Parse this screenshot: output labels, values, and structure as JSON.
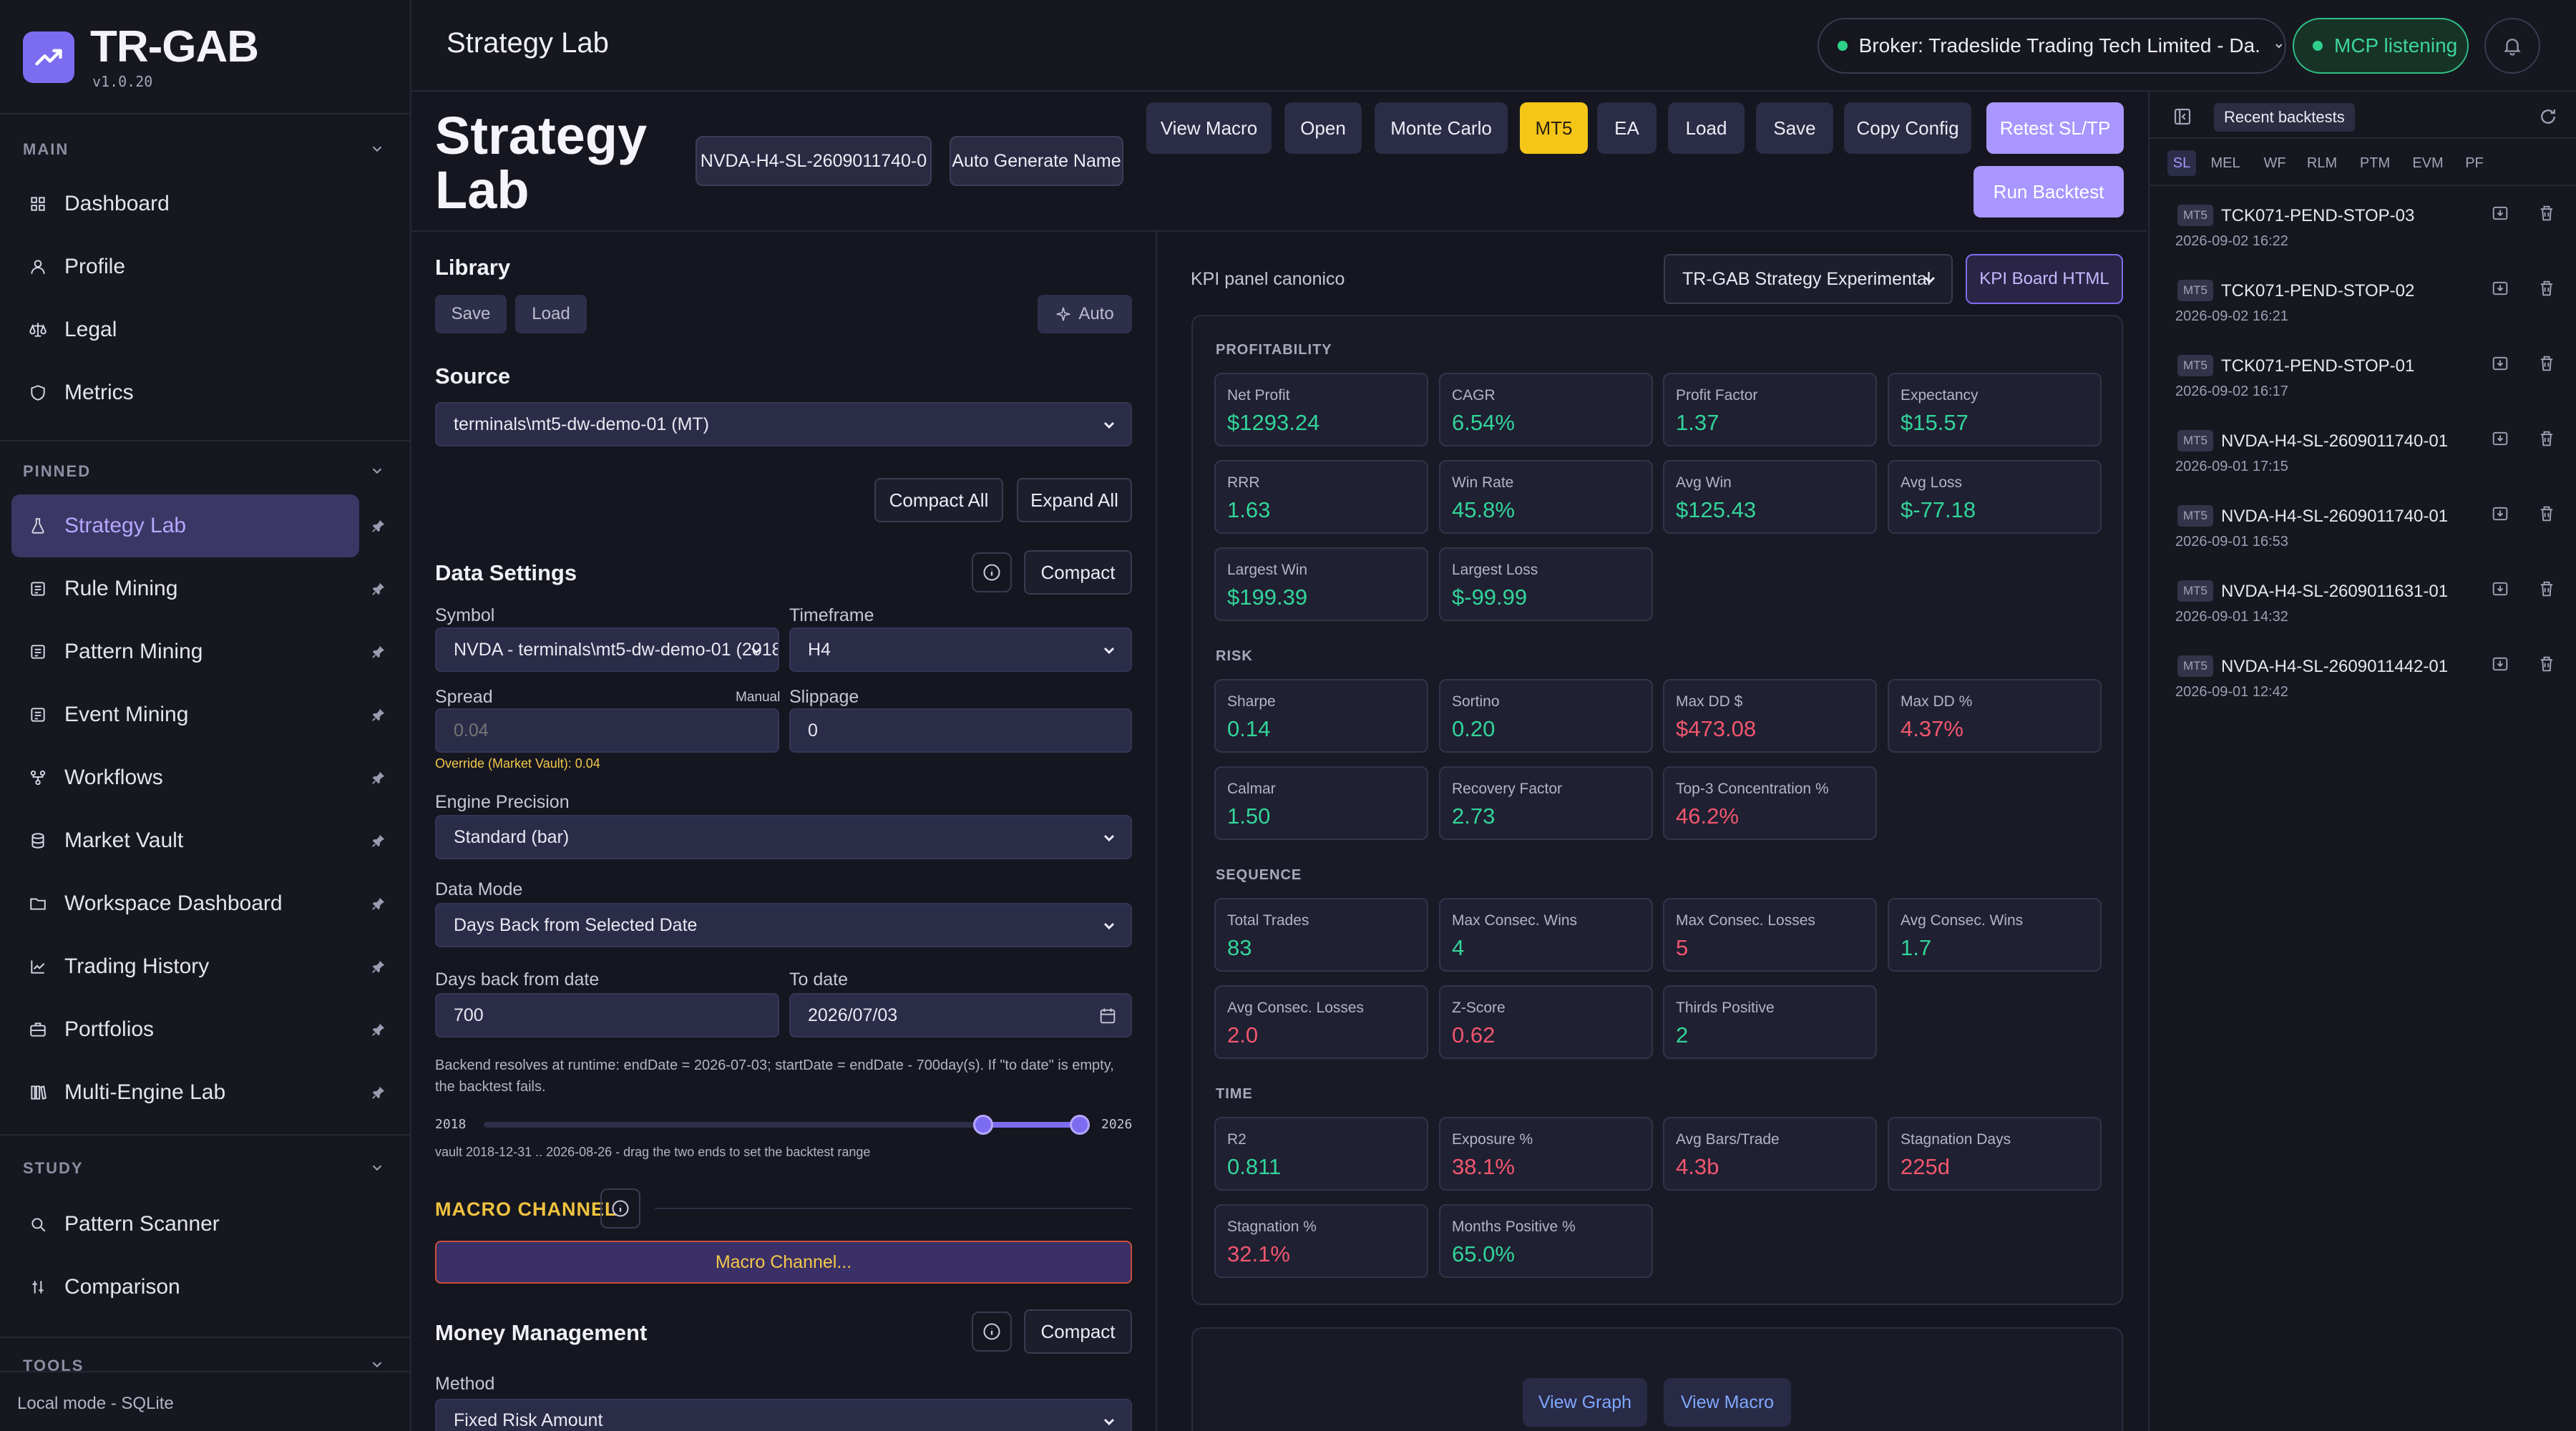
{
  "app": {
    "title": "TR-GAB",
    "version": "v1.0.20",
    "footer": "Local mode - SQLite"
  },
  "sidebar": {
    "sections": {
      "main": "MAIN",
      "pinned": "PINNED",
      "study": "STUDY",
      "tools": "TOOLS"
    },
    "main_items": [
      {
        "label": "Dashboard",
        "icon": "grid-icon"
      },
      {
        "label": "Profile",
        "icon": "user-icon"
      },
      {
        "label": "Legal",
        "icon": "scale-icon"
      },
      {
        "label": "Metrics",
        "icon": "shield-icon"
      }
    ],
    "pinned_items": [
      {
        "label": "Strategy Lab",
        "icon": "flask-icon",
        "active": true
      },
      {
        "label": "Rule Mining",
        "icon": "list-icon"
      },
      {
        "label": "Pattern Mining",
        "icon": "list-icon"
      },
      {
        "label": "Event Mining",
        "icon": "list-icon"
      },
      {
        "label": "Workflows",
        "icon": "workflow-icon"
      },
      {
        "label": "Market Vault",
        "icon": "database-icon"
      },
      {
        "label": "Workspace Dashboard",
        "icon": "folder-icon"
      },
      {
        "label": "Trading History",
        "icon": "chart-icon"
      },
      {
        "label": "Portfolios",
        "icon": "briefcase-icon"
      },
      {
        "label": "Multi-Engine Lab",
        "icon": "books-icon"
      }
    ],
    "study_items": [
      {
        "label": "Pattern Scanner",
        "icon": "search-icon"
      },
      {
        "label": "Comparison",
        "icon": "compare-icon"
      }
    ]
  },
  "topbar": {
    "title": "Strategy Lab",
    "broker": "Broker: Tradeslide Trading Tech Limited - Da...",
    "mcp": "MCP listening",
    "accent": "#7c6cf0"
  },
  "header": {
    "title_line1": "Strategy",
    "title_line2": "Lab",
    "strategy_name": "NVDA-H4-SL-2609011740-0",
    "auto_generate": "Auto Generate Name",
    "buttons": {
      "view_macro": "View Macro",
      "open": "Open",
      "monte_carlo": "Monte Carlo",
      "mt5": "MT5",
      "ea": "EA",
      "load": "Load",
      "save": "Save",
      "copy_config": "Copy Config",
      "retest": "Retest SL/TP",
      "run": "Run Backtest"
    }
  },
  "config": {
    "library": {
      "title": "Library",
      "save": "Save",
      "load": "Load",
      "auto": "Auto"
    },
    "source": {
      "title": "Source",
      "value": "terminals\\mt5-dw-demo-01 (MT)"
    },
    "compact_all": "Compact All",
    "expand_all": "Expand All",
    "data_settings": {
      "title": "Data Settings",
      "compact": "Compact",
      "symbol_label": "Symbol",
      "symbol_value": "NVDA - terminals\\mt5-dw-demo-01 (2018",
      "timeframe_label": "Timeframe",
      "timeframe_value": "H4",
      "spread_label": "Spread",
      "spread_manual": "Manual",
      "spread_placeholder": "0.04",
      "slippage_label": "Slippage",
      "slippage_value": "0",
      "override_note": "Override (Market Vault): 0.04",
      "precision_label": "Engine Precision",
      "precision_value": "Standard (bar)",
      "mode_label": "Data Mode",
      "mode_value": "Days Back from Selected Date",
      "days_label": "Days back from date",
      "days_value": "700",
      "to_label": "To date",
      "to_value": "2026/07/03",
      "backend_note": "Backend resolves at runtime: endDate = 2026-07-03; startDate = endDate - 700day(s). If \"to date\" is empty, the backtest fails.",
      "range_start": "2018",
      "range_end": "2026",
      "range_start_frac": 0.83,
      "range_end_frac": 0.99,
      "vault_note": "vault 2018-12-31 .. 2026-08-26 - drag the two ends to set the backtest range"
    },
    "macro": {
      "title": "MACRO CHANNEL",
      "button": "Macro Channel..."
    },
    "money": {
      "title": "Money Management",
      "compact": "Compact",
      "method_label": "Method",
      "method_value": "Fixed Risk Amount"
    }
  },
  "kpi": {
    "panel_label": "KPI panel canonico",
    "select": "TR-GAB Strategy Experimental",
    "board_btn": "KPI Board HTML",
    "groups": [
      {
        "title": "PROFITABILITY",
        "cards": [
          {
            "label": "Net Profit",
            "value": "$1293.24",
            "tone": "pos"
          },
          {
            "label": "CAGR",
            "value": "6.54%",
            "tone": "pos"
          },
          {
            "label": "Profit Factor",
            "value": "1.37",
            "tone": "pos"
          },
          {
            "label": "Expectancy",
            "value": "$15.57",
            "tone": "pos"
          },
          {
            "label": "RRR",
            "value": "1.63",
            "tone": "pos"
          },
          {
            "label": "Win Rate",
            "value": "45.8%",
            "tone": "pos"
          },
          {
            "label": "Avg Win",
            "value": "$125.43",
            "tone": "pos"
          },
          {
            "label": "Avg Loss",
            "value": "$-77.18",
            "tone": "pos"
          },
          {
            "label": "Largest Win",
            "value": "$199.39",
            "tone": "pos"
          },
          {
            "label": "Largest Loss",
            "value": "$-99.99",
            "tone": "pos"
          }
        ]
      },
      {
        "title": "RISK",
        "cards": [
          {
            "label": "Sharpe",
            "value": "0.14",
            "tone": "pos"
          },
          {
            "label": "Sortino",
            "value": "0.20",
            "tone": "pos"
          },
          {
            "label": "Max DD $",
            "value": "$473.08",
            "tone": "neg"
          },
          {
            "label": "Max DD %",
            "value": "4.37%",
            "tone": "neg"
          },
          {
            "label": "Calmar",
            "value": "1.50",
            "tone": "pos"
          },
          {
            "label": "Recovery Factor",
            "value": "2.73",
            "tone": "pos"
          },
          {
            "label": "Top-3 Concentration %",
            "value": "46.2%",
            "tone": "neg"
          }
        ]
      },
      {
        "title": "SEQUENCE",
        "cards": [
          {
            "label": "Total Trades",
            "value": "83",
            "tone": "pos"
          },
          {
            "label": "Max Consec. Wins",
            "value": "4",
            "tone": "pos"
          },
          {
            "label": "Max Consec. Losses",
            "value": "5",
            "tone": "neg"
          },
          {
            "label": "Avg Consec. Wins",
            "value": "1.7",
            "tone": "pos"
          },
          {
            "label": "Avg Consec. Losses",
            "value": "2.0",
            "tone": "neg"
          },
          {
            "label": "Z-Score",
            "value": "0.62",
            "tone": "neg"
          },
          {
            "label": "Thirds Positive",
            "value": "2",
            "tone": "pos"
          }
        ]
      },
      {
        "title": "TIME",
        "cards": [
          {
            "label": "R2",
            "value": "0.811",
            "tone": "pos"
          },
          {
            "label": "Exposure %",
            "value": "38.1%",
            "tone": "neg"
          },
          {
            "label": "Avg Bars/Trade",
            "value": "4.3b",
            "tone": "neg"
          },
          {
            "label": "Stagnation Days",
            "value": "225d",
            "tone": "neg"
          },
          {
            "label": "Stagnation %",
            "value": "32.1%",
            "tone": "neg"
          },
          {
            "label": "Months Positive %",
            "value": "65.0%",
            "tone": "pos"
          }
        ]
      }
    ],
    "view_graph": "View Graph",
    "view_macro": "View Macro"
  },
  "recent": {
    "title": "Recent backtests",
    "tabs": [
      "SL",
      "MEL",
      "WF",
      "RLM",
      "PTM",
      "EVM",
      "PF"
    ],
    "active_tab": "SL",
    "items": [
      {
        "badge": "MT5",
        "name": "TCK071-PEND-STOP-03",
        "date": "2026-09-02 16:22"
      },
      {
        "badge": "MT5",
        "name": "TCK071-PEND-STOP-02",
        "date": "2026-09-02 16:21"
      },
      {
        "badge": "MT5",
        "name": "TCK071-PEND-STOP-01",
        "date": "2026-09-02 16:17"
      },
      {
        "badge": "MT5",
        "name": "NVDA-H4-SL-2609011740-01",
        "date": "2026-09-01 17:15"
      },
      {
        "badge": "MT5",
        "name": "NVDA-H4-SL-2609011740-01",
        "date": "2026-09-01 16:53"
      },
      {
        "badge": "MT5",
        "name": "NVDA-H4-SL-2609011631-01",
        "date": "2026-09-01 14:32"
      },
      {
        "badge": "MT5",
        "name": "NVDA-H4-SL-2609011442-01",
        "date": "2026-09-01 12:42"
      }
    ]
  }
}
